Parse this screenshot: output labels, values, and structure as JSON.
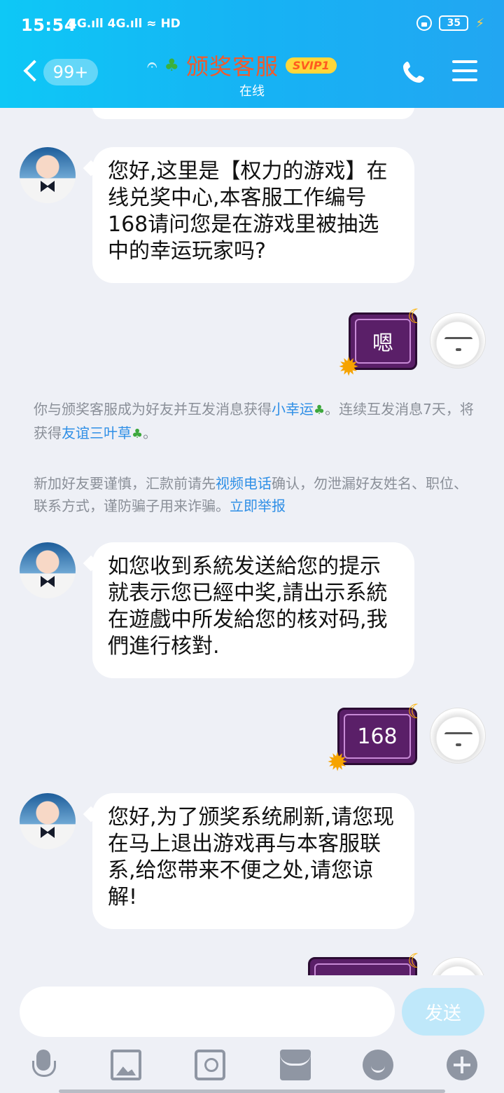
{
  "status_bar": {
    "time": "15:54",
    "network": "4G.ıll 4G.ıll ≈ HD",
    "battery": "35"
  },
  "header": {
    "unread_count": "99+",
    "title": "颁奖客服",
    "vip_badge": "SVIP1",
    "status": "在线",
    "icons": [
      "back-chevron-icon",
      "ear-icon",
      "sprout-icon",
      "phone-icon",
      "menu-icon"
    ]
  },
  "messages": [
    {
      "side": "left",
      "text": "您好,这里是【权力的游戏】在线兑奖中心,本客服工作编号168请问您是在游戏里被抽选中的幸运玩家吗?"
    },
    {
      "side": "right",
      "text": "嗯"
    },
    {
      "side": "left",
      "text": "如您收到系統发送給您的提示就表示您已經中奖,請出示系統在遊戲中所发給您的核对码,我們進行核對."
    },
    {
      "side": "right",
      "text": "168"
    },
    {
      "side": "left",
      "text": "您好,为了颁奖系统刷新,请您现在马上退出游戏再与本客服联系,给您带来不便之处,请您谅解!"
    }
  ],
  "notices": {
    "friend": {
      "before": "你与颁奖客服成为好友并互发消息获得",
      "link1": "小幸运",
      "middle": "。连续互发消息7天，将获得",
      "link2": "友谊三叶草",
      "after": "。"
    },
    "warning": {
      "before": "新加好友要谨慎，汇款前请先",
      "link1": "视频电话",
      "middle": "确认，勿泄漏好友姓名、职位、联系方式，谨防骗子用来诈骗。",
      "link2": "立即举报"
    }
  },
  "input": {
    "placeholder": "",
    "send_label": "发送"
  },
  "toolbar": [
    "mic-icon",
    "image-icon",
    "camera-icon",
    "red-packet-icon",
    "emoji-icon",
    "plus-icon"
  ]
}
